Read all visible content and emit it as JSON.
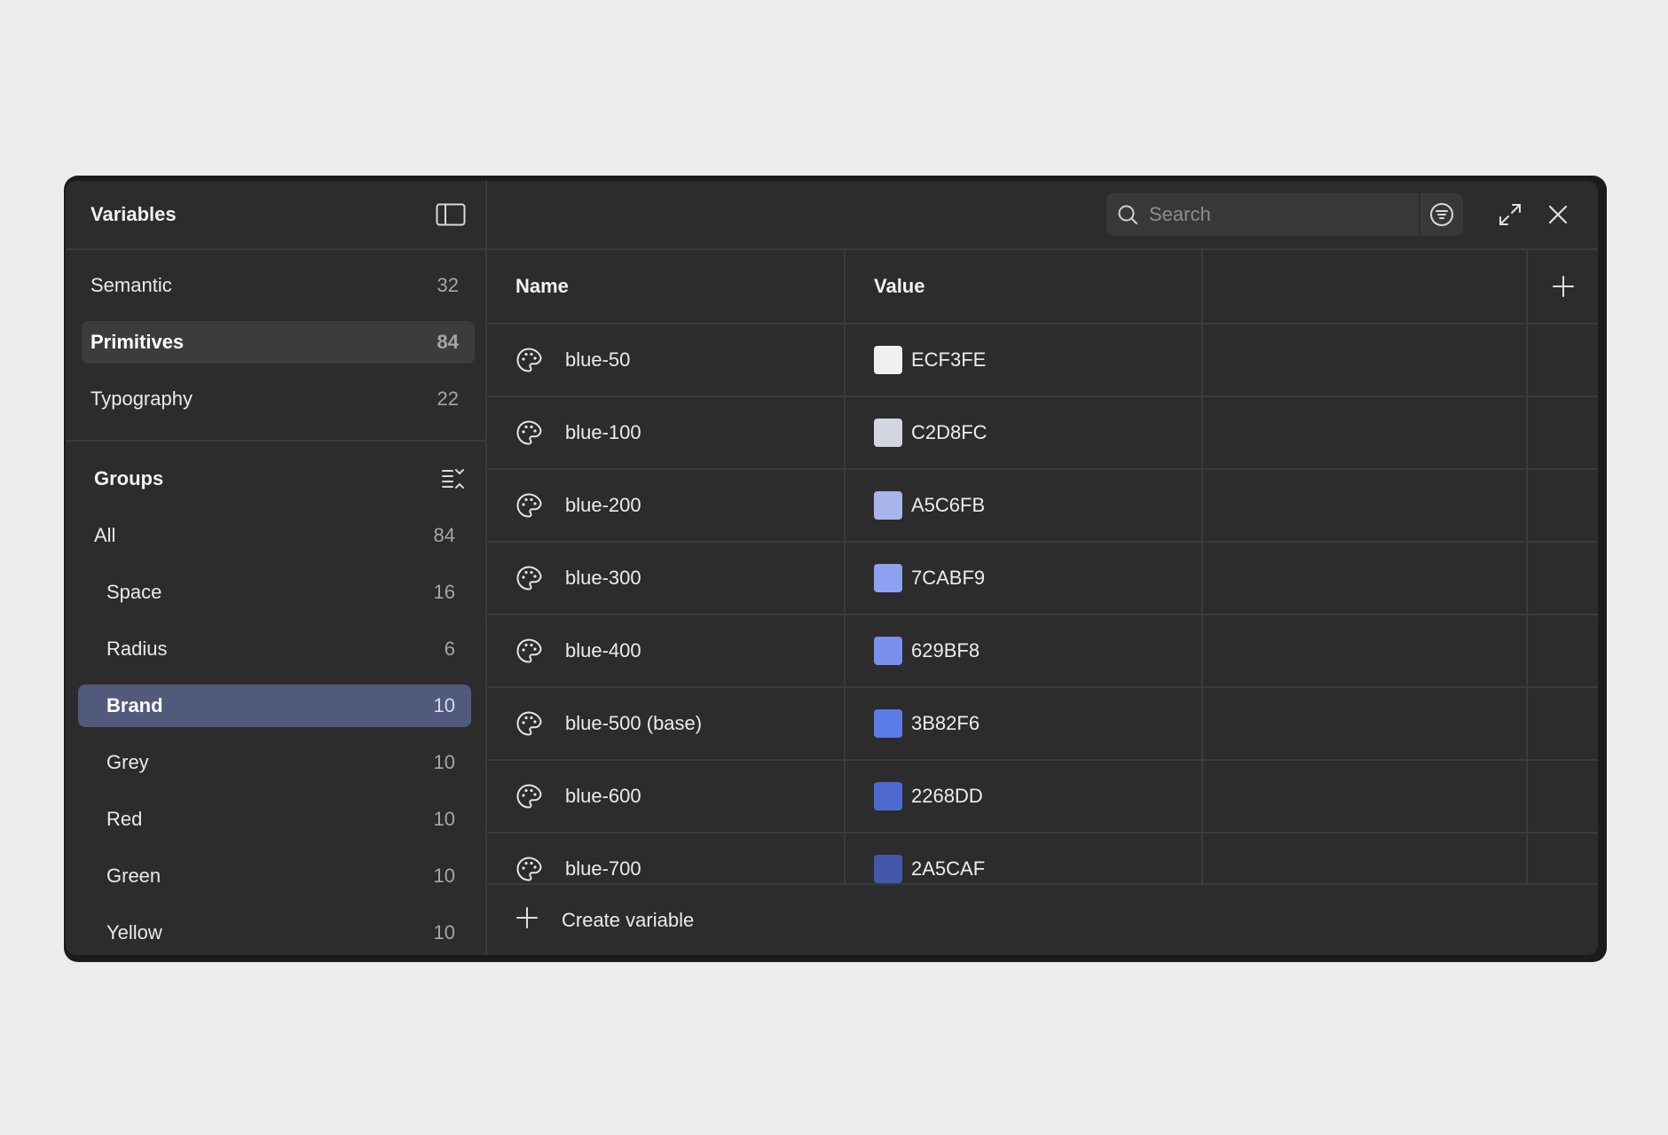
{
  "sidebar": {
    "title": "Variables",
    "collections": [
      {
        "label": "Semantic",
        "count": "32",
        "active": false
      },
      {
        "label": "Primitives",
        "count": "84",
        "active": true
      },
      {
        "label": "Typography",
        "count": "22",
        "active": false
      }
    ],
    "groups_title": "Groups",
    "groups": [
      {
        "label": "All",
        "count": "84",
        "level": "top",
        "active": false
      },
      {
        "label": "Space",
        "count": "16",
        "level": "sub",
        "active": false
      },
      {
        "label": "Radius",
        "count": "6",
        "level": "sub",
        "active": false
      },
      {
        "label": "Brand",
        "count": "10",
        "level": "sub",
        "active": true
      },
      {
        "label": "Grey",
        "count": "10",
        "level": "sub",
        "active": false
      },
      {
        "label": "Red",
        "count": "10",
        "level": "sub",
        "active": false
      },
      {
        "label": "Green",
        "count": "10",
        "level": "sub",
        "active": false
      },
      {
        "label": "Yellow",
        "count": "10",
        "level": "sub",
        "active": false
      }
    ]
  },
  "toolbar": {
    "search_placeholder": "Search",
    "icons": [
      "search-icon",
      "filter-icon",
      "expand-icon",
      "close-icon"
    ]
  },
  "table": {
    "headers": {
      "name": "Name",
      "value": "Value"
    },
    "rows": [
      {
        "name": "blue-50",
        "value": "ECF3FE",
        "color": "#f0f0f0"
      },
      {
        "name": "blue-100",
        "value": "C2D8FC",
        "color": "#d3d5e0"
      },
      {
        "name": "blue-200",
        "value": "A5C6FB",
        "color": "#a9b5ea"
      },
      {
        "name": "blue-300",
        "value": "7CABF9",
        "color": "#8ea1ef"
      },
      {
        "name": "blue-400",
        "value": "629BF8",
        "color": "#7a90ec"
      },
      {
        "name": "blue-500 (base)",
        "value": "3B82F6",
        "color": "#5b7be8"
      },
      {
        "name": "blue-600",
        "value": "2268DD",
        "color": "#4e6ad1"
      },
      {
        "name": "blue-700",
        "value": "2A5CAF",
        "color": "#4458aa"
      }
    ]
  },
  "footer": {
    "create_label": "Create variable"
  }
}
